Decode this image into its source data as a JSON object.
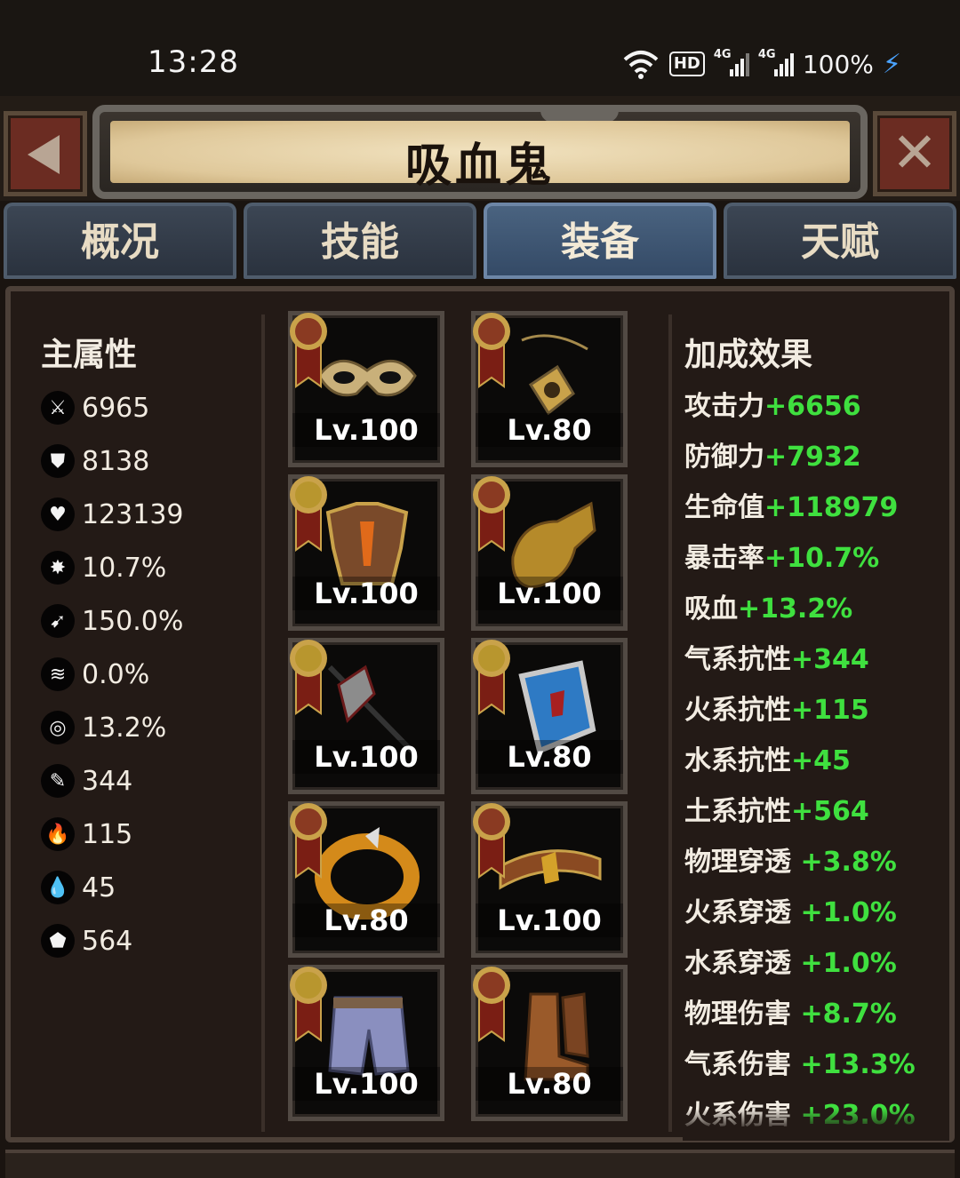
{
  "status_bar": {
    "time": "13:28",
    "hd": "HD",
    "net1": "4G",
    "net2": "4G",
    "battery": "100%"
  },
  "header": {
    "title": "吸血鬼"
  },
  "tabs": [
    {
      "label": "概况",
      "active": false
    },
    {
      "label": "技能",
      "active": false
    },
    {
      "label": "装备",
      "active": true
    },
    {
      "label": "天赋",
      "active": false
    }
  ],
  "main_stats": {
    "title": "主属性",
    "items": [
      {
        "icon": "sword-icon",
        "value": "6965"
      },
      {
        "icon": "shield-icon",
        "value": "8138"
      },
      {
        "icon": "heart-icon",
        "value": "123139"
      },
      {
        "icon": "burst-icon",
        "value": "10.7%"
      },
      {
        "icon": "crit-damage-icon",
        "value": "150.0%"
      },
      {
        "icon": "wind-boot-icon",
        "value": "0.0%"
      },
      {
        "icon": "lifesteal-icon",
        "value": "13.2%"
      },
      {
        "icon": "feather-icon",
        "value": "344"
      },
      {
        "icon": "fire-icon",
        "value": "115"
      },
      {
        "icon": "water-drop-icon",
        "value": "45"
      },
      {
        "icon": "rock-icon",
        "value": "564"
      }
    ]
  },
  "equipment": [
    {
      "name": "mask",
      "level": "Lv.100",
      "medal": "bronze"
    },
    {
      "name": "amulet",
      "level": "Lv.80",
      "medal": "bronze"
    },
    {
      "name": "chest-armor",
      "level": "Lv.100",
      "medal": "gold"
    },
    {
      "name": "gauntlet",
      "level": "Lv.100",
      "medal": "bronze"
    },
    {
      "name": "halberd",
      "level": "Lv.100",
      "medal": "gold"
    },
    {
      "name": "shield",
      "level": "Lv.80",
      "medal": "gold"
    },
    {
      "name": "ring",
      "level": "Lv.80",
      "medal": "bronze"
    },
    {
      "name": "belt",
      "level": "Lv.100",
      "medal": "bronze"
    },
    {
      "name": "pants",
      "level": "Lv.100",
      "medal": "gold"
    },
    {
      "name": "boots",
      "level": "Lv.80",
      "medal": "bronze"
    }
  ],
  "bonus": {
    "title": "加成效果",
    "items": [
      {
        "label": "攻击力",
        "value": "+6656"
      },
      {
        "label": "防御力",
        "value": "+7932"
      },
      {
        "label": "生命值",
        "value": "+118979"
      },
      {
        "label": "暴击率",
        "value": "+10.7%"
      },
      {
        "label": "吸血",
        "value": "+13.2%"
      },
      {
        "label": "气系抗性",
        "value": "+344"
      },
      {
        "label": "火系抗性",
        "value": "+115"
      },
      {
        "label": "水系抗性",
        "value": "+45"
      },
      {
        "label": "土系抗性",
        "value": "+564"
      },
      {
        "label": "物理穿透",
        "value": " +3.8%"
      },
      {
        "label": "火系穿透",
        "value": " +1.0%"
      },
      {
        "label": "水系穿透",
        "value": " +1.0%"
      },
      {
        "label": "物理伤害",
        "value": " +8.7%"
      },
      {
        "label": "气系伤害",
        "value": " +13.3%"
      },
      {
        "label": "火系伤害",
        "value": " +23.0%"
      }
    ]
  },
  "colors": {
    "bonus_value": "#3fe03f",
    "active_tab": "#4a6380",
    "medal_gold": "#b8962e",
    "medal_bronze": "#8a3a22"
  }
}
